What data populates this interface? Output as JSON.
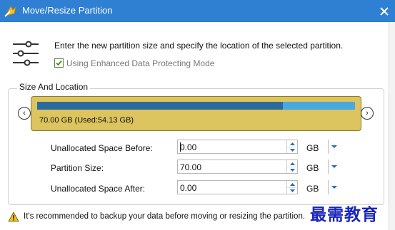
{
  "window": {
    "title": "Move/Resize Partition",
    "close_glyph": "✕",
    "app_icon": "partition-wizard-icon"
  },
  "header": {
    "icon": "sliders-icon",
    "instruction": "Enter the new partition size and specify the location of the selected partition.",
    "checkbox_label": "Using Enhanced Data Protecting Mode",
    "checkbox_checked": true
  },
  "size_and_location": {
    "group_label": "Size And Location",
    "partition": {
      "label": "70.00 GB (Used:54.13 GB)",
      "used_fraction": 0.773,
      "block_color": "#dcc45e",
      "used_color": "#2a6b9c",
      "free_color": "#48a8df"
    },
    "nav_left": "‹",
    "nav_right": "›"
  },
  "fields": [
    {
      "label": "Unallocated Space Before:",
      "value": "0.00",
      "unit": "GB"
    },
    {
      "label": "Partition Size:",
      "value": "70.00",
      "unit": "GB"
    },
    {
      "label": "Unallocated Space After:",
      "value": "0.00",
      "unit": "GB"
    }
  ],
  "footer": {
    "warning_icon": "warning-icon",
    "warning_text": "It's recommended to backup your data before moving or resizing the partition."
  },
  "watermark": {
    "text": "最需教育"
  },
  "colors": {
    "title_bar": "#2f7fd2",
    "accent": "#1f6fc4"
  }
}
